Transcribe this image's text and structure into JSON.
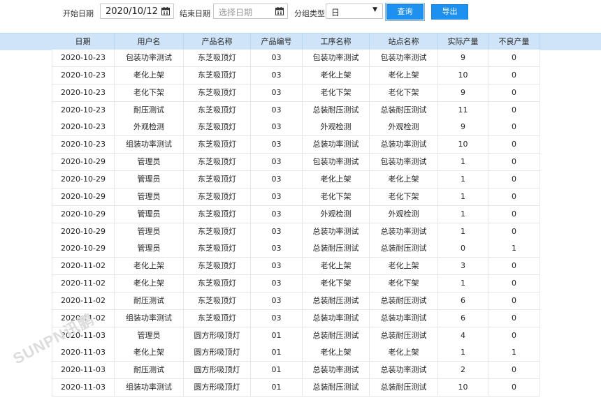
{
  "filters": {
    "start_label": "开始日期",
    "start_value": "2020/10/12",
    "end_label": "结束日期",
    "end_placeholder": "选择日期",
    "group_label": "分组类型",
    "group_value": "日",
    "query_label": "查询",
    "export_label": "导出"
  },
  "table": {
    "columns": [
      "日期",
      "用户名",
      "产品名称",
      "产品编号",
      "工序名称",
      "站点名称",
      "实际产量",
      "不良产量"
    ],
    "rows": [
      [
        "2020-10-23",
        "包装功率测试",
        "东芝吸顶灯",
        "03",
        "包装功率测试",
        "包装功率测试",
        "9",
        "0"
      ],
      [
        "2020-10-23",
        "老化上架",
        "东芝吸顶灯",
        "03",
        "老化上架",
        "老化上架",
        "10",
        "0"
      ],
      [
        "2020-10-23",
        "老化下架",
        "东芝吸顶灯",
        "03",
        "老化下架",
        "老化下架",
        "9",
        "0"
      ],
      [
        "2020-10-23",
        "耐压测试",
        "东芝吸顶灯",
        "03",
        "总装耐压测试",
        "总装耐压测试",
        "11",
        "0"
      ],
      [
        "2020-10-23",
        "外观检测",
        "东芝吸顶灯",
        "03",
        "外观检测",
        "外观检测",
        "9",
        "0"
      ],
      [
        "2020-10-23",
        "组装功率测试",
        "东芝吸顶灯",
        "03",
        "总装功率测试",
        "总装功率测试",
        "10",
        "0"
      ],
      [
        "2020-10-29",
        "管理员",
        "东芝吸顶灯",
        "03",
        "包装功率测试",
        "包装功率测试",
        "1",
        "0"
      ],
      [
        "2020-10-29",
        "管理员",
        "东芝吸顶灯",
        "03",
        "老化上架",
        "老化上架",
        "1",
        "0"
      ],
      [
        "2020-10-29",
        "管理员",
        "东芝吸顶灯",
        "03",
        "老化下架",
        "老化下架",
        "1",
        "0"
      ],
      [
        "2020-10-29",
        "管理员",
        "东芝吸顶灯",
        "03",
        "外观检测",
        "外观检测",
        "1",
        "0"
      ],
      [
        "2020-10-29",
        "管理员",
        "东芝吸顶灯",
        "03",
        "总装功率测试",
        "总装功率测试",
        "1",
        "0"
      ],
      [
        "2020-10-29",
        "管理员",
        "东芝吸顶灯",
        "03",
        "总装耐压测试",
        "总装耐压测试",
        "0",
        "1"
      ],
      [
        "2020-11-02",
        "老化上架",
        "东芝吸顶灯",
        "03",
        "老化上架",
        "老化上架",
        "3",
        "0"
      ],
      [
        "2020-11-02",
        "老化上架",
        "东芝吸顶灯",
        "03",
        "老化下架",
        "老化下架",
        "1",
        "0"
      ],
      [
        "2020-11-02",
        "耐压测试",
        "东芝吸顶灯",
        "03",
        "总装耐压测试",
        "总装耐压测试",
        "6",
        "0"
      ],
      [
        "2020-11-02",
        "组装功率测试",
        "东芝吸顶灯",
        "03",
        "总装功率测试",
        "总装功率测试",
        "6",
        "0"
      ],
      [
        "2020-11-03",
        "管理员",
        "圆方形吸顶灯",
        "01",
        "总装耐压测试",
        "总装耐压测试",
        "4",
        "0"
      ],
      [
        "2020-11-03",
        "老化上架",
        "圆方形吸顶灯",
        "01",
        "老化上架",
        "老化上架",
        "1",
        "1"
      ],
      [
        "2020-11-03",
        "耐压测试",
        "圆方形吸顶灯",
        "01",
        "总装功率测试",
        "总装功率测试",
        "2",
        "0"
      ],
      [
        "2020-11-03",
        "组装功率测试",
        "圆方形吸顶灯",
        "01",
        "总装耐压测试",
        "总装耐压测试",
        "10",
        "0"
      ]
    ]
  },
  "watermark": "SUNPN讯鹏",
  "colors": {
    "primary_button": "#1e90f0",
    "header_bg": "#cfe4f8"
  }
}
